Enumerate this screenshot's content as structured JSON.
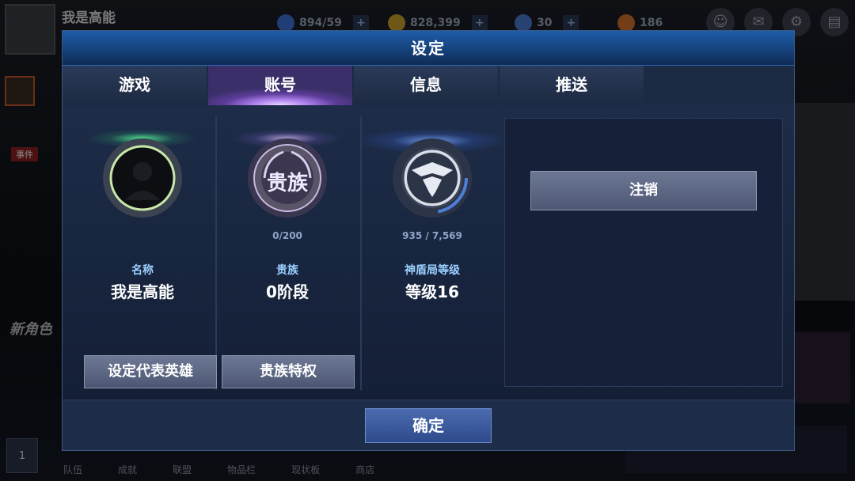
{
  "hud": {
    "player_name": "我是高能",
    "energy": "894/59",
    "gold": "828,399",
    "crystals": "30",
    "stamina": "186",
    "event_label": "事件",
    "new_char_label": "新角色"
  },
  "bottom_nav": [
    "队伍",
    "成就",
    "联盟",
    "物品栏",
    "现状板",
    "商店"
  ],
  "bottom_left_badge": "1",
  "dialog": {
    "title": "设定",
    "tabs": [
      {
        "label": "游戏",
        "active": false
      },
      {
        "label": "账号",
        "active": true
      },
      {
        "label": "信息",
        "active": false
      },
      {
        "label": "推送",
        "active": false
      }
    ],
    "profile": {
      "label": "名称",
      "value": "我是高能",
      "button": "设定代表英雄"
    },
    "noble": {
      "emblem_text": "贵族",
      "progress": "0/200",
      "label": "贵族",
      "value": "0阶段",
      "button": "贵族特权"
    },
    "shield": {
      "progress": "935 / 7,569",
      "label": "神盾局等级",
      "value": "等级16"
    },
    "logout_label": "注销",
    "confirm_label": "确定"
  },
  "colors": {
    "title_bar": "#1e5da8",
    "active_tab": "#b285f0",
    "label_blue": "#9ad0ff",
    "confirm_button": "#2e4a8a"
  }
}
